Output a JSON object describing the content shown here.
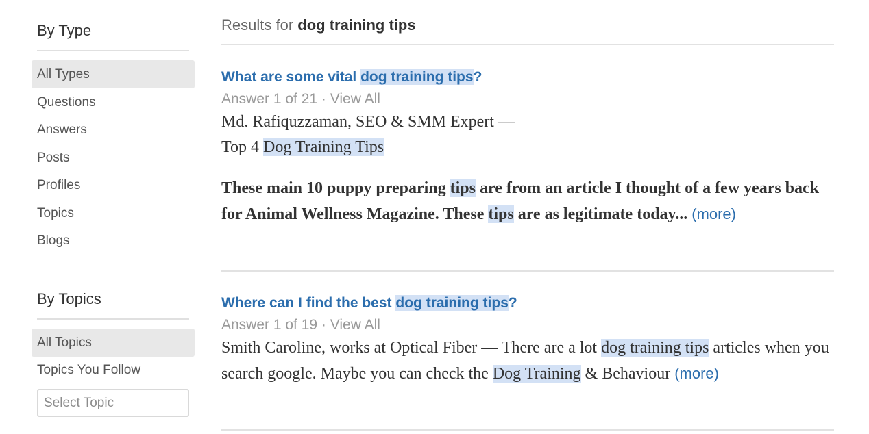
{
  "sidebar": {
    "by_type": {
      "heading": "By Type",
      "items": [
        "All Types",
        "Questions",
        "Answers",
        "Posts",
        "Profiles",
        "Topics",
        "Blogs"
      ]
    },
    "by_topics": {
      "heading": "By Topics",
      "items": [
        "All Topics",
        "Topics You Follow"
      ],
      "select_placeholder": "Select Topic"
    }
  },
  "results": {
    "prefix": "Results for",
    "query": "dog training tips"
  },
  "items": [
    {
      "title_pre": "What are some vital",
      "title_hl": "dog training tips",
      "title_post": "?",
      "answer_count": "Answer 1 of 21",
      "sep": " · ",
      "view_all": "View All",
      "author": "Md. Rafiquzzaman, SEO & SMM Expert —",
      "headline_pre": "Top 4",
      "headline_hl": "Dog Training Tips",
      "excerpt_1": "These main 10 puppy preparing",
      "excerpt_hl_1": "tips",
      "excerpt_2": "are from an article I thought of a few years back for Animal Wellness Magazine. These",
      "excerpt_hl_2": "tips",
      "excerpt_3": "are as legitimate today...",
      "more": "(more)"
    },
    {
      "title_pre": "Where can I find the best",
      "title_hl": "dog training tips",
      "title_post": "?",
      "answer_count": "Answer 1 of 19",
      "sep": " · ",
      "view_all": "View All",
      "text_1": "Smith Caroline, works at Optical Fiber — There are a lot",
      "text_hl_1": "dog training tips",
      "text_2": "articles when you search google. Maybe you can check the",
      "text_hl_2": "Dog Training",
      "text_3": "& Behaviour",
      "more": "(more)"
    }
  ]
}
